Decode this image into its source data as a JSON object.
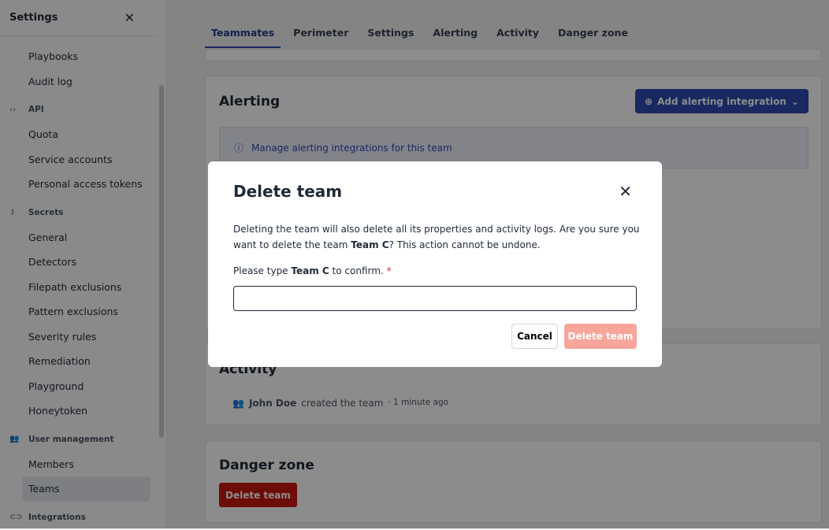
{
  "sidebar": {
    "title": "Settings",
    "items": [
      {
        "type": "item",
        "label": "Playbooks"
      },
      {
        "type": "item",
        "label": "Audit log"
      },
      {
        "type": "group",
        "label": "API",
        "icon": "code-icon"
      },
      {
        "type": "item",
        "label": "Quota"
      },
      {
        "type": "item",
        "label": "Service accounts"
      },
      {
        "type": "item",
        "label": "Personal access tokens"
      },
      {
        "type": "group",
        "label": "Secrets",
        "icon": "key-icon"
      },
      {
        "type": "item",
        "label": "General"
      },
      {
        "type": "item",
        "label": "Detectors"
      },
      {
        "type": "item",
        "label": "Filepath exclusions"
      },
      {
        "type": "item",
        "label": "Pattern exclusions"
      },
      {
        "type": "item",
        "label": "Severity rules"
      },
      {
        "type": "item",
        "label": "Remediation"
      },
      {
        "type": "item",
        "label": "Playground"
      },
      {
        "type": "item",
        "label": "Honeytoken"
      },
      {
        "type": "group",
        "label": "User management",
        "icon": "users-icon"
      },
      {
        "type": "item",
        "label": "Members"
      },
      {
        "type": "item",
        "label": "Teams",
        "active": true
      },
      {
        "type": "group",
        "label": "Integrations",
        "icon": "link-icon"
      }
    ]
  },
  "tabs": [
    {
      "label": "Teammates",
      "active": true
    },
    {
      "label": "Perimeter"
    },
    {
      "label": "Settings"
    },
    {
      "label": "Alerting"
    },
    {
      "label": "Activity"
    },
    {
      "label": "Danger zone"
    }
  ],
  "alerting": {
    "title": "Alerting",
    "add_button": "Add alerting integration",
    "info": "Manage alerting integrations for this team"
  },
  "activity": {
    "title": "Activity",
    "user": "John Doe",
    "action": "created the team",
    "time": "· 1 minute ago"
  },
  "danger": {
    "title": "Danger zone",
    "button": "Delete team"
  },
  "modal": {
    "title": "Delete team",
    "body_1": "Deleting the team will also delete all its properties and activity logs. Are you sure you want to delete the team ",
    "team": "Team C",
    "body_2": "? This action cannot be undone.",
    "label_1": "Please type ",
    "label_2": " to confirm.",
    "required": "*",
    "input_value": "",
    "cancel": "Cancel",
    "confirm": "Delete team"
  },
  "colors": {
    "primary": "#2f4ab0",
    "danger": "#c8170d",
    "danger_disabled": "#f8a59c"
  }
}
